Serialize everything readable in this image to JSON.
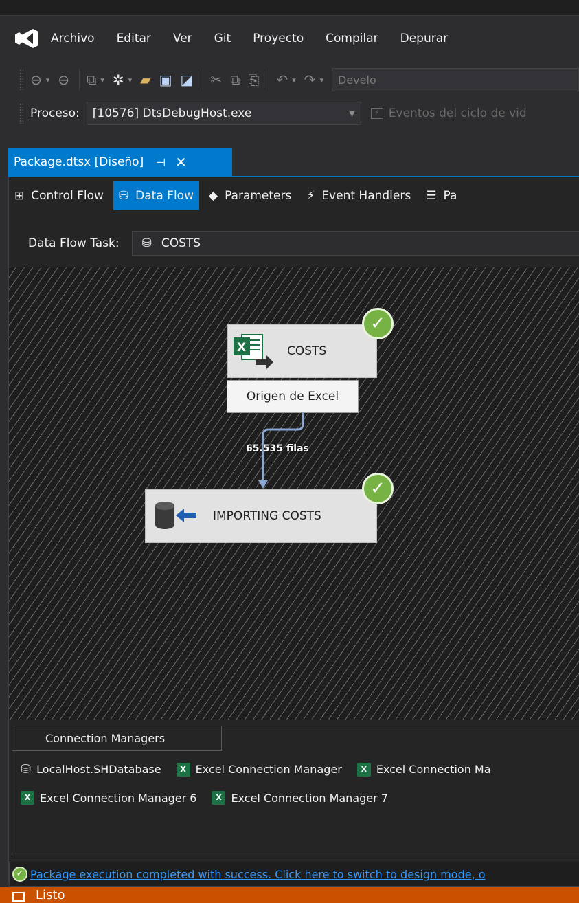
{
  "menu": {
    "items": [
      "Archivo",
      "Editar",
      "Ver",
      "Git",
      "Proyecto",
      "Compilar",
      "Depurar"
    ]
  },
  "toolbar": {
    "config_combo_text": "Develo"
  },
  "process_bar": {
    "label": "Proceso:",
    "value": "[10576] DtsDebugHost.exe",
    "events_text": "Eventos del ciclo de vid"
  },
  "document_tab": {
    "title": "Package.dtsx [Diseño]"
  },
  "designer_tabs": [
    {
      "label": "Control Flow",
      "active": false
    },
    {
      "label": "Data Flow",
      "active": true
    },
    {
      "label": "Parameters",
      "active": false
    },
    {
      "label": "Event Handlers",
      "active": false
    },
    {
      "label": "Pa",
      "active": false
    }
  ],
  "data_flow_task": {
    "label": "Data Flow Task:",
    "value": "COSTS"
  },
  "canvas": {
    "source_component": "COSTS",
    "source_tooltip": "Origen de Excel",
    "path_label": "65.535 filas",
    "destination_component": "IMPORTING COSTS"
  },
  "connection_managers": {
    "tab_label": "Connection Managers",
    "row1": [
      {
        "name": "LocalHost.SHDatabase",
        "icon": "database-icon"
      },
      {
        "name": "Excel Connection Manager",
        "icon": "excel-connection-icon"
      },
      {
        "name": "Excel Connection Ma",
        "icon": "excel-connection-icon"
      }
    ],
    "row2": [
      {
        "name": "Excel Connection Manager 6",
        "icon": "excel-connection-icon"
      },
      {
        "name": "Excel Connection Manager 7",
        "icon": "excel-connection-icon"
      }
    ]
  },
  "execution_message": "Package execution completed with success. Click here to switch to design mode, o",
  "statusbar": {
    "text": "Listo"
  },
  "colors": {
    "accent": "#007acc",
    "statusbar": "#ca5100",
    "success": "#77b244",
    "link": "#3399ff"
  }
}
